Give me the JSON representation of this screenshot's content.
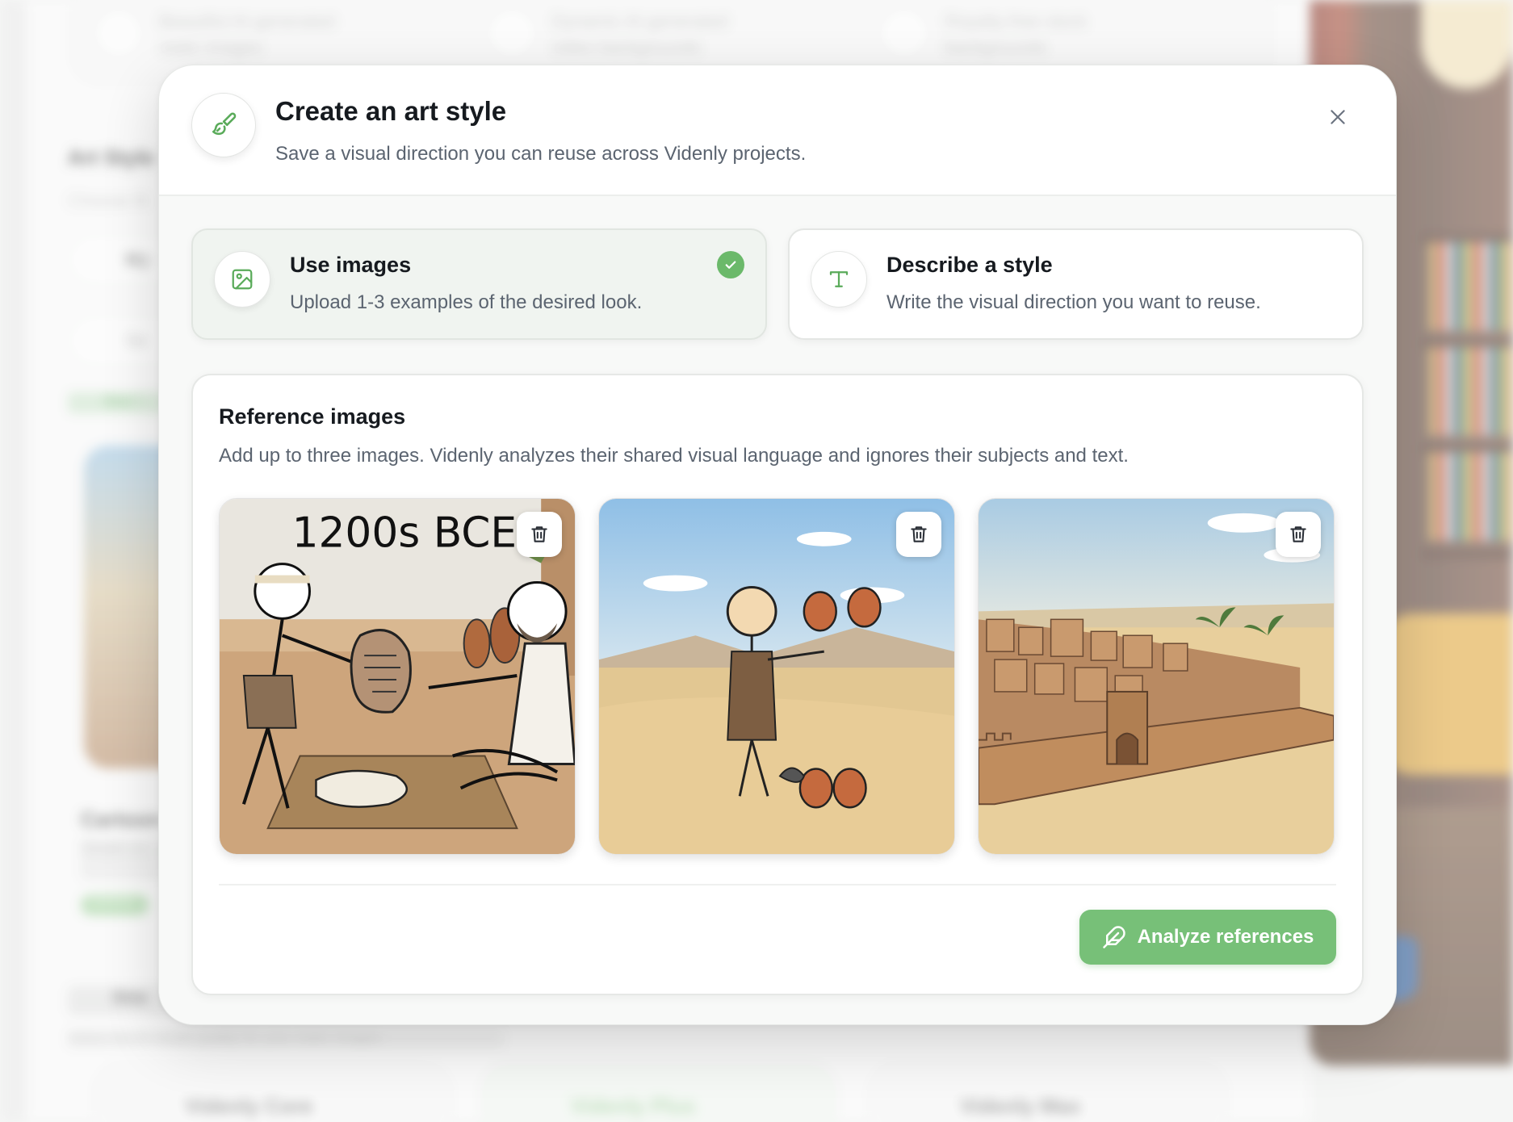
{
  "background": {
    "top_cards": [
      {
        "text": "Beautiful AI-generated static images"
      },
      {
        "text": "Dynamic AI-generated video backgrounds"
      },
      {
        "text": "Royalty-free stock backgrounds"
      }
    ],
    "art_style_heading": "Art Style",
    "art_style_sub": "Choose th",
    "my_pill": "My",
    "search_placeholder": "Se",
    "see_link": "See i",
    "card_caption": "Cartoon",
    "caption_sub": "Simple ca… evoke a p…",
    "tag": "Cartoon",
    "image_heading": "Ima",
    "image_sub": "Select the AI model quality for your static images",
    "model_cards": [
      "Videnly Core",
      "Videnly Plus",
      "Videnly Max"
    ]
  },
  "modal": {
    "title": "Create an art style",
    "subtitle": "Save a visual direction you can reuse across Videnly projects.",
    "header_icon": "paintbrush-icon",
    "close_icon": "close-icon"
  },
  "options": [
    {
      "title": "Use images",
      "desc": "Upload 1-3 examples of the desired look.",
      "icon": "image-icon",
      "selected": true
    },
    {
      "title": "Describe a style",
      "desc": "Write the visual direction you want to reuse.",
      "icon": "text-icon",
      "selected": false
    }
  ],
  "references": {
    "title": "Reference images",
    "desc": "Add up to three images. Videnly analyzes their shared visual language and ignores their subjects and text.",
    "images": [
      {
        "caption_text": "1200s BCE",
        "alt": "stick figure handing stone tablet to seated bearded man"
      },
      {
        "alt": "stick figure juggling clay pots in desert"
      },
      {
        "alt": "walled desert city with palm trees"
      }
    ],
    "analyze_label": "Analyze references",
    "analyze_icon": "feather-icon"
  },
  "colors": {
    "accent": "#77c078",
    "check": "#6bb96a",
    "icon_green": "#5aab5a"
  }
}
